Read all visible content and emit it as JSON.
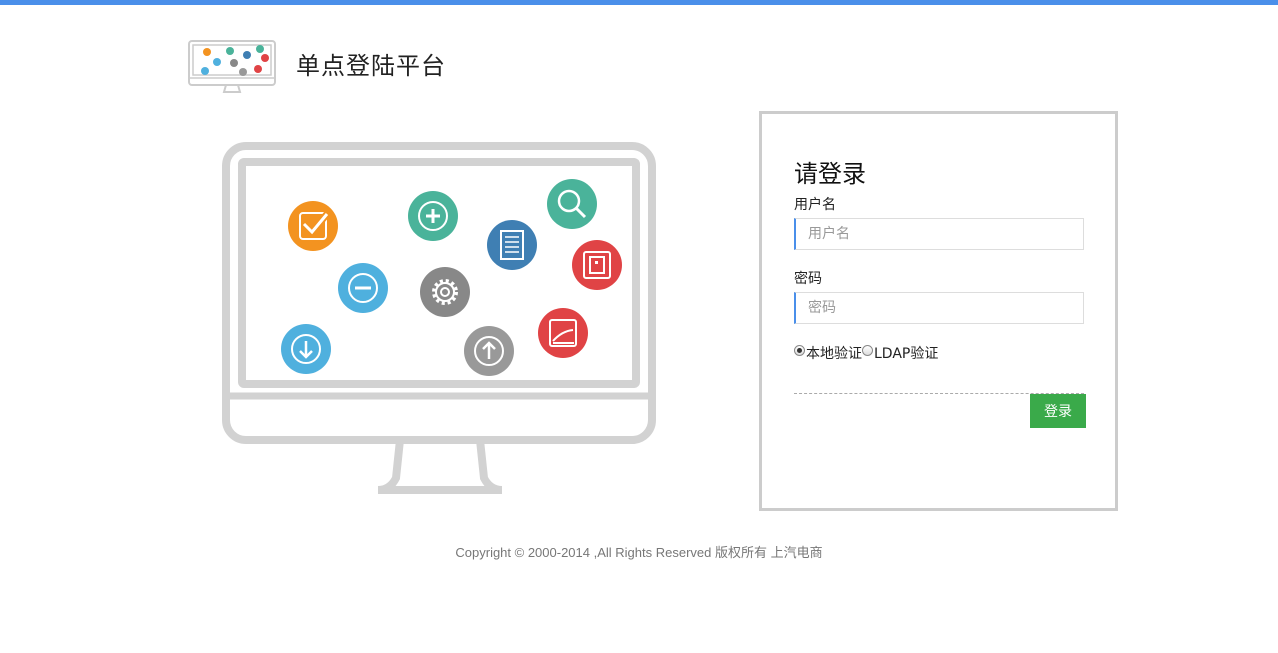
{
  "header": {
    "title": "单点登陆平台",
    "accent_color": "#4a8fea",
    "logo_icon": "monitor-apps-icon"
  },
  "illustration": {
    "icon": "monitor-apps-icon",
    "apps": [
      {
        "name": "check-icon",
        "color": "#f39320"
      },
      {
        "name": "plus-icon",
        "color": "#4ab39a"
      },
      {
        "name": "search-icon",
        "color": "#4ab39a"
      },
      {
        "name": "document-list-icon",
        "color": "#3f7fb3"
      },
      {
        "name": "minus-icon",
        "color": "#4fb0de"
      },
      {
        "name": "gear-icon",
        "color": "#888888"
      },
      {
        "name": "square-icon",
        "color": "#e04345"
      },
      {
        "name": "download-icon",
        "color": "#4fb0de"
      },
      {
        "name": "upload-icon",
        "color": "#999999"
      },
      {
        "name": "chart-icon",
        "color": "#e04345"
      }
    ]
  },
  "login": {
    "title": "请登录",
    "username_label": "用户名",
    "username_placeholder": "用户名",
    "username_value": "",
    "password_label": "密码",
    "password_placeholder": "密码",
    "password_value": "",
    "auth_options": [
      {
        "label": "本地验证",
        "checked": true
      },
      {
        "label": "LDAP验证",
        "checked": false
      }
    ],
    "submit_label": "登录",
    "submit_color": "#3aaa4a"
  },
  "footer": {
    "copyright": "Copyright © 2000-2014 ,All Rights Reserved 版权所有 上汽电商"
  }
}
